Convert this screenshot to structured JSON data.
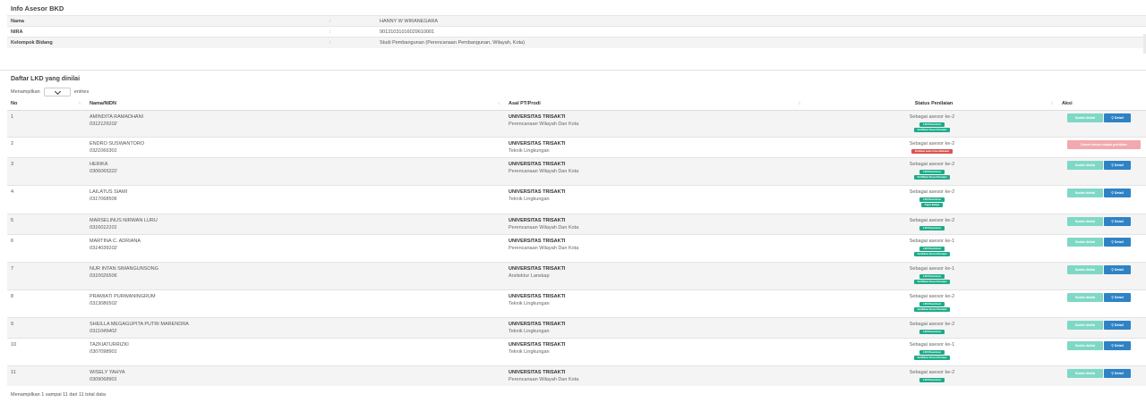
{
  "info": {
    "title": "Info Asesor BKD",
    "rows": [
      {
        "label": "Nama",
        "sep": ":",
        "value": "HANNY W WIRANEGARA"
      },
      {
        "label": "NIRA",
        "sep": ":",
        "value": "90131031016029610001"
      },
      {
        "label": "Kelompok Bidang",
        "sep": ":",
        "value": "Studi Pembangunan (Perencanaan Pembangunan, Wilayah, Kota)"
      }
    ]
  },
  "lkd": {
    "title": "Daftar LKD yang dinilai",
    "length_prefix": "Menampilkan",
    "length_suffix": "entries",
    "columns": {
      "no": "No",
      "nama": "Nama/NIDN",
      "asal": "Asal PT/Prodi",
      "status": "Status Penilaian",
      "aksi": "Aksi"
    },
    "rows": [
      {
        "no": "1",
        "nama": "AMINDITA RAMADHANI",
        "nidn": "0312129102",
        "univ": "UNIVERSITAS TRISAKTI",
        "prodi": "Perencanaan Wilayah Dan Kota",
        "status": "Sebagai asesor ke-2",
        "badges": [
          {
            "text": "LKD Diseminasi",
            "color": "green"
          },
          {
            "text": "Sertifikasi Dosen Disetujui",
            "color": "green"
          }
        ],
        "action": "done"
      },
      {
        "no": "2",
        "nama": "ENDRO SUSWANTORO",
        "nidn": "0321066301",
        "univ": "UNIVERSITAS TRISAKTI",
        "prodi": "Teknik Lingkungan",
        "status": "Sebagai asesor ke-2",
        "badges": [
          {
            "text": "Penilaian belum bisa dilakukan",
            "color": "red"
          }
        ],
        "action": "pending"
      },
      {
        "no": "3",
        "nama": "HERIKA",
        "nidn": "0306065222",
        "univ": "UNIVERSITAS TRISAKTI",
        "prodi": "Perencanaan Wilayah Dan Kota",
        "status": "Sebagai asesor ke-2",
        "badges": [
          {
            "text": "LKD Diseminasi",
            "color": "green"
          },
          {
            "text": "Sertifikasi Dosen Disetujui",
            "color": "green"
          }
        ],
        "action": "done"
      },
      {
        "no": "4",
        "nama": "LAILATUS SIAMI",
        "nidn": "0317068506",
        "univ": "UNIVERSITAS TRISAKTI",
        "prodi": "Teknik Lingkungan",
        "status": "Sebagai asesor ke-2",
        "badges": [
          {
            "text": "LKD Diseminasi",
            "color": "green"
          },
          {
            "text": "Tugas Belajar",
            "color": "green"
          }
        ],
        "action": "done"
      },
      {
        "no": "5",
        "nama": "MARSELINUS NIRWAN LURU",
        "nidn": "0316012101",
        "univ": "UNIVERSITAS TRISAKTI",
        "prodi": "Perencanaan Wilayah Dan Kota",
        "status": "Sebagai asesor ke-2",
        "badges": [
          {
            "text": "LKD Diseminasi",
            "color": "green"
          }
        ],
        "action": "done"
      },
      {
        "no": "6",
        "nama": "MARTINA C. ADRIANA",
        "nidn": "0314039102",
        "univ": "UNIVERSITAS TRISAKTI",
        "prodi": "Perencanaan Wilayah Dan Kota",
        "status": "Sebagai asesor ke-1",
        "badges": [
          {
            "text": "LKD Diseminasi",
            "color": "green"
          },
          {
            "text": "Sertifikasi Dosen Disetujui",
            "color": "green"
          }
        ],
        "action": "done"
      },
      {
        "no": "7",
        "nama": "NUR INTAN SIMANGUNSONG",
        "nidn": "0310026506",
        "univ": "UNIVERSITAS TRISAKTI",
        "prodi": "Arsitektur Lanskap",
        "status": "Sebagai asesor ke-1",
        "badges": [
          {
            "text": "LKD Diseminasi",
            "color": "green"
          },
          {
            "text": "Sertifikasi Dosen Disetujui",
            "color": "green"
          }
        ],
        "action": "done"
      },
      {
        "no": "8",
        "nama": "PRAMIATI PURWANINGRUM",
        "nidn": "0313086502",
        "univ": "UNIVERSITAS TRISAKTI",
        "prodi": "Teknik Lingkungan",
        "status": "Sebagai asesor ke-2",
        "badges": [
          {
            "text": "LKD Diseminasi",
            "color": "green"
          },
          {
            "text": "Sertifikasi Dosen Disetujui",
            "color": "green"
          }
        ],
        "action": "done"
      },
      {
        "no": "9",
        "nama": "SHEILLA MEGAGUPITA PUTRI MARENDRA",
        "nidn": "0311049402",
        "univ": "UNIVERSITAS TRISAKTI",
        "prodi": "Teknik Lingkungan",
        "status": "Sebagai asesor ke-2",
        "badges": [
          {
            "text": "LKD Diseminasi",
            "color": "green"
          }
        ],
        "action": "done"
      },
      {
        "no": "10",
        "nama": "TAZKIATURRIZKI",
        "nidn": "0307098901",
        "univ": "UNIVERSITAS TRISAKTI",
        "prodi": "Teknik Lingkungan",
        "status": "Sebagai asesor ke-1",
        "badges": [
          {
            "text": "LKD Diseminasi",
            "color": "green"
          },
          {
            "text": "Sertifikasi Dosen Disetujui",
            "color": "green"
          }
        ],
        "action": "done"
      },
      {
        "no": "11",
        "nama": "WISELY YAHYA",
        "nidn": "0309068901",
        "univ": "UNIVERSITAS TRISAKTI",
        "prodi": "Perencanaan Wilayah Dan Kota",
        "status": "Sebagai asesor ke-2",
        "badges": [
          {
            "text": "LKD Diseminasi",
            "color": "green"
          }
        ],
        "action": "done"
      }
    ],
    "buttons": {
      "done": "Sudah dinilai",
      "detail": "Detail",
      "pending": "Dosen belum siapan penilaian"
    },
    "footer": "Menampilkan 1 sampai 11 dari 11 total data"
  },
  "colors": {
    "accent_green": "#1fab89",
    "detail_blue": "#2f83c4",
    "done_button": "#7fd8c6",
    "pending_button": "#f2a9ae",
    "badge_red": "#d9534f"
  }
}
